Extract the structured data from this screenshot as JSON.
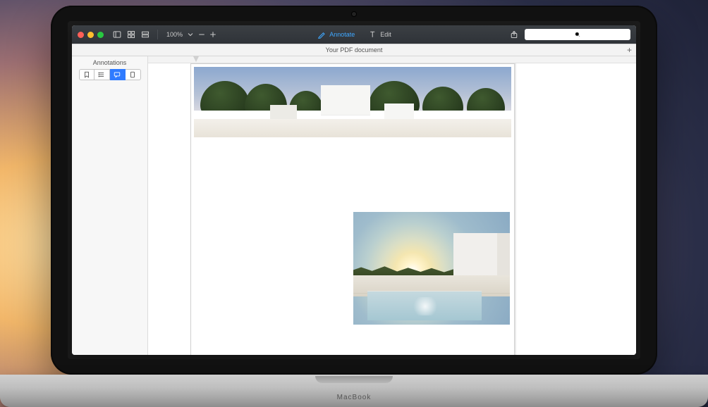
{
  "app": {
    "traffic_colors": {
      "close": "#ff5f57",
      "min": "#ffbd2e",
      "max": "#28c840"
    }
  },
  "toolbar": {
    "zoom_pct": "100%",
    "annotate_label": "Annotate",
    "edit_label": "Edit",
    "accent_color": "#3fa8ff"
  },
  "tabbar": {
    "document_title": "Your PDF document",
    "plus": "+"
  },
  "sidebar": {
    "title": "Annotations",
    "tab_icons": [
      "bookmark-icon",
      "outline-icon",
      "annotations-icon",
      "thumbnails-icon"
    ],
    "selected_index": 2
  },
  "laptop_brand": "MacBook"
}
